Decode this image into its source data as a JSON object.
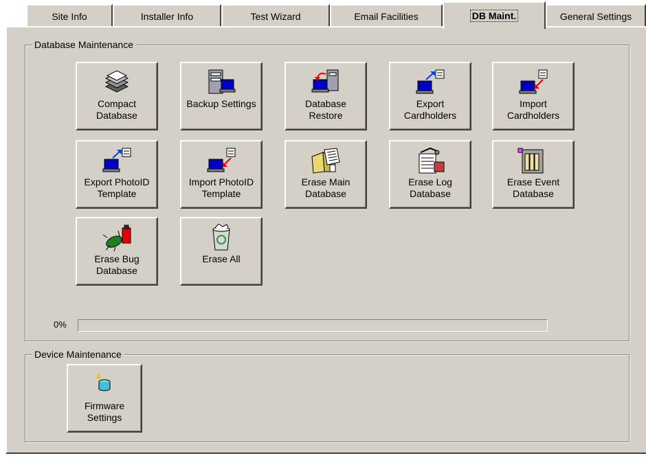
{
  "tabs": [
    {
      "label": "Site Info",
      "active": false
    },
    {
      "label": "Installer Info",
      "active": false
    },
    {
      "label": "Test Wizard",
      "active": false
    },
    {
      "label": "Email Facilities",
      "active": false
    },
    {
      "label": "DB Maint.",
      "active": true
    },
    {
      "label": "General Settings",
      "active": false
    }
  ],
  "db_group": {
    "title": "Database Maintenance",
    "buttons": [
      {
        "label": "Compact\nDatabase",
        "icon": "compact-database-icon"
      },
      {
        "label": "Backup Settings",
        "icon": "backup-settings-icon"
      },
      {
        "label": "Database\nRestore",
        "icon": "database-restore-icon"
      },
      {
        "label": "Export\nCardholders",
        "icon": "export-cardholders-icon"
      },
      {
        "label": "Import\nCardholders",
        "icon": "import-cardholders-icon"
      },
      {
        "label": "Export PhotoID\nTemplate",
        "icon": "export-photoid-icon"
      },
      {
        "label": "Import PhotoID\nTemplate",
        "icon": "import-photoid-icon"
      },
      {
        "label": "Erase Main\nDatabase",
        "icon": "erase-main-database-icon"
      },
      {
        "label": "Erase Log\nDatabase",
        "icon": "erase-log-database-icon"
      },
      {
        "label": "Erase Event\nDatabase",
        "icon": "erase-event-database-icon"
      },
      {
        "label": "Erase Bug\nDatabase",
        "icon": "erase-bug-database-icon"
      },
      {
        "label": "Erase All",
        "icon": "recycle-bin-icon"
      }
    ],
    "progress": {
      "label": "0%",
      "value": 0
    }
  },
  "device_group": {
    "title": "Device Maintenance",
    "buttons": [
      {
        "label": "Firmware\nSettings",
        "icon": "firmware-settings-icon"
      }
    ]
  },
  "colors": {
    "face": "#d4d0c8",
    "highlight": "#ffffff",
    "shadow": "#404040",
    "accent": "#0a246a"
  }
}
